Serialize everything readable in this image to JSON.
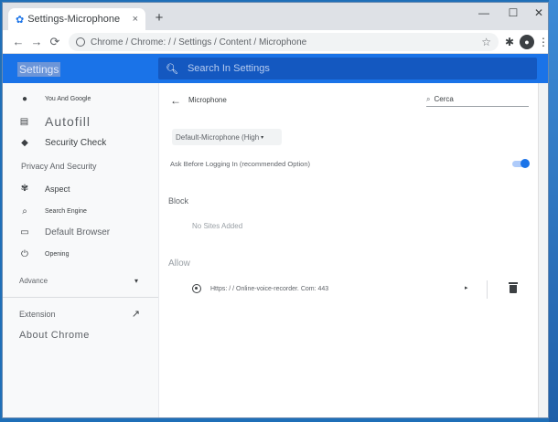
{
  "browser": {
    "tab_title": "Settings-Microphone",
    "tab_close": "×",
    "new_tab": "+",
    "window_minimize": "—",
    "window_maximize": "☐",
    "window_close": "✕",
    "back": "←",
    "forward": "→",
    "reload": "⟳",
    "url": "Chrome / Chrome: / / Settings / Content / Microphone",
    "bookmark": "☆",
    "extensions": "✱",
    "profile": "●",
    "menu": "⋮"
  },
  "header": {
    "title": "Settings",
    "search_placeholder": "Search In Settings"
  },
  "sidebar": {
    "items": [
      {
        "label": "You And Google",
        "icon": "person-icon"
      },
      {
        "label": "Autofill",
        "icon": "clipboard-icon"
      },
      {
        "label": "Security Check",
        "icon": "shield-icon"
      },
      {
        "label": "Privacy And Security",
        "icon": ""
      },
      {
        "label": "Aspect",
        "icon": "palette-icon"
      },
      {
        "label": "Search Engine",
        "icon": "search-icon"
      },
      {
        "label": "Default Browser",
        "icon": "browser-icon"
      },
      {
        "label": "Opening",
        "icon": "power-icon"
      }
    ],
    "advanced": "Advance",
    "advanced_caret": "▾",
    "extensions": "Extension",
    "extensions_icon": "↗",
    "about": "About Chrome"
  },
  "main": {
    "back_arrow": "←",
    "title": "Microphone",
    "search_value": "Cerca",
    "device_select": "Default-Microphone (High",
    "select_caret": "▾",
    "ask_label": "Ask Before Logging In (recommended Option)",
    "toggle_on": true,
    "block_heading": "Block",
    "block_empty": "No Sites Added",
    "allow_heading": "Allow",
    "allowed_sites": [
      {
        "url": "Https: / / Online-voice-recorder. Com: 443",
        "arrow": "▸"
      }
    ]
  },
  "colors": {
    "accent": "#1a73e8",
    "header_search": "#1458c0",
    "sidebar_bg": "#f8f9fa",
    "text_primary": "#3c4043"
  }
}
